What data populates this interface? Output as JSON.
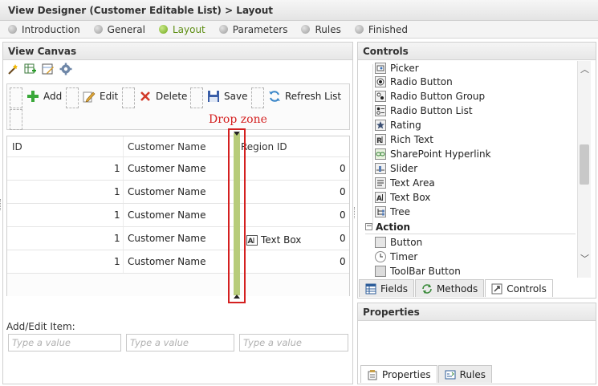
{
  "window": {
    "title": "View Designer (Customer Editable List) > Layout"
  },
  "steps": [
    {
      "label": "Introduction",
      "active": false
    },
    {
      "label": "General",
      "active": false
    },
    {
      "label": "Layout",
      "active": true
    },
    {
      "label": "Parameters",
      "active": false
    },
    {
      "label": "Rules",
      "active": false
    },
    {
      "label": "Finished",
      "active": false
    }
  ],
  "canvas": {
    "title": "View Canvas",
    "toolbar": {
      "add": "Add",
      "edit": "Edit",
      "delete": "Delete",
      "save": "Save",
      "refresh": "Refresh List"
    },
    "dropzone_label": "Drop zone",
    "grid": {
      "headers": [
        "ID",
        "Customer Name",
        "Region ID"
      ],
      "rows": [
        {
          "id": "1",
          "name": "Customer Name",
          "region": "0"
        },
        {
          "id": "1",
          "name": "Customer Name",
          "region": "0"
        },
        {
          "id": "1",
          "name": "Customer Name",
          "region": "0"
        },
        {
          "id": "1",
          "name": "Customer Name",
          "region": "0"
        },
        {
          "id": "1",
          "name": "Customer Name",
          "region": "0"
        }
      ],
      "textbox_label": "Text Box"
    },
    "add_edit_label": "Add/Edit Item:",
    "inputs_placeholder": "Type a value"
  },
  "controls": {
    "title": "Controls",
    "items": [
      {
        "label": "Picker",
        "icon": "picker-icon"
      },
      {
        "label": "Radio Button",
        "icon": "radio-button-icon"
      },
      {
        "label": "Radio Button Group",
        "icon": "radio-group-icon"
      },
      {
        "label": "Radio Button List",
        "icon": "radio-list-icon"
      },
      {
        "label": "Rating",
        "icon": "star-icon"
      },
      {
        "label": "Rich Text",
        "icon": "rich-text-icon"
      },
      {
        "label": "SharePoint Hyperlink",
        "icon": "link-icon"
      },
      {
        "label": "Slider",
        "icon": "slider-icon"
      },
      {
        "label": "Text Area",
        "icon": "text-area-icon"
      },
      {
        "label": "Text Box",
        "icon": "text-box-icon"
      },
      {
        "label": "Tree",
        "icon": "tree-icon"
      }
    ],
    "section_action": "Action",
    "action_items": [
      {
        "label": "Button",
        "icon": "button-icon"
      },
      {
        "label": "Timer",
        "icon": "timer-icon"
      },
      {
        "label": "ToolBar Button",
        "icon": "toolbar-button-icon"
      }
    ],
    "tabs": [
      {
        "label": "Fields",
        "active": false
      },
      {
        "label": "Methods",
        "active": false
      },
      {
        "label": "Controls",
        "active": true
      }
    ]
  },
  "properties": {
    "title": "Properties",
    "tabs": [
      {
        "label": "Properties",
        "active": true
      },
      {
        "label": "Rules",
        "active": false
      }
    ]
  },
  "colors": {
    "active_step": "#5c8d12",
    "dropzone_border": "#d42020",
    "dropzone_fill": "#b7cc7a"
  }
}
